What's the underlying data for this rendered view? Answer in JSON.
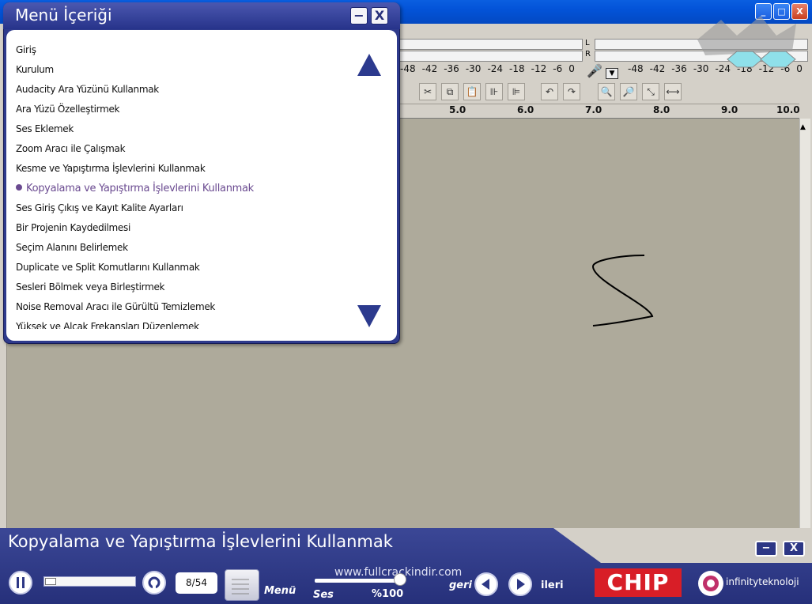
{
  "window": {
    "buttons": {
      "minimize": "_",
      "maximize": "□",
      "close": "X"
    }
  },
  "meters": {
    "left_scale": [
      "-48",
      "-42",
      "-36",
      "-30",
      "-24",
      "-18",
      "-12",
      "-6",
      "0"
    ],
    "right_scale": [
      "-48",
      "-42",
      "-36",
      "-30",
      "-24",
      "-18",
      "-12",
      "-6",
      "0"
    ],
    "channel_left": "L",
    "channel_right": "R"
  },
  "ruler": {
    "ticks": [
      "5.0",
      "6.0",
      "7.0",
      "8.0",
      "9.0",
      "10.0"
    ]
  },
  "menu_panel": {
    "title": "Menü İçeriği",
    "minimize_label": "−",
    "close_label": "X",
    "items": [
      "Giriş",
      "Kurulum",
      "Audacity Ara Yüzünü Kullanmak",
      "Ara Yüzü Özelleştirmek",
      "Ses Eklemek",
      "Zoom Aracı ile Çalışmak",
      "Kesme ve Yapıştırma İşlevlerini Kullanmak",
      "Kopyalama ve Yapıştırma İşlevlerini Kullanmak",
      "Ses Giriş Çıkış ve Kayıt Kalite Ayarları",
      "Bir Projenin Kaydedilmesi",
      "Seçim Alanını Belirlemek",
      "Duplicate ve Split Komutlarını Kullanmak",
      "Sesleri Bölmek veya Birleştirmek",
      "Noise Removal Aracı ile Gürültü Temizlemek",
      "Yüksek ve Alçak Frekansları Düzenlemek"
    ],
    "active_index": 7
  },
  "player": {
    "title": "Kopyalama ve Yapıştırma İşlevlerini Kullanmak",
    "progress": 0.12,
    "page": "8/54",
    "menu_label": "Menü",
    "watermark": "www.fullcrackindir.com",
    "volume_label": "Ses",
    "volume_pct": "%100",
    "back_label": "geri",
    "next_label": "ileri",
    "brand": "CHIP",
    "sponsor": "infinityteknoloji",
    "minimize_label": "−",
    "close_label": "X"
  },
  "colors": {
    "accent": "#2e3a8c",
    "active_item": "#6a4a90",
    "brand_red": "#d81e27"
  }
}
